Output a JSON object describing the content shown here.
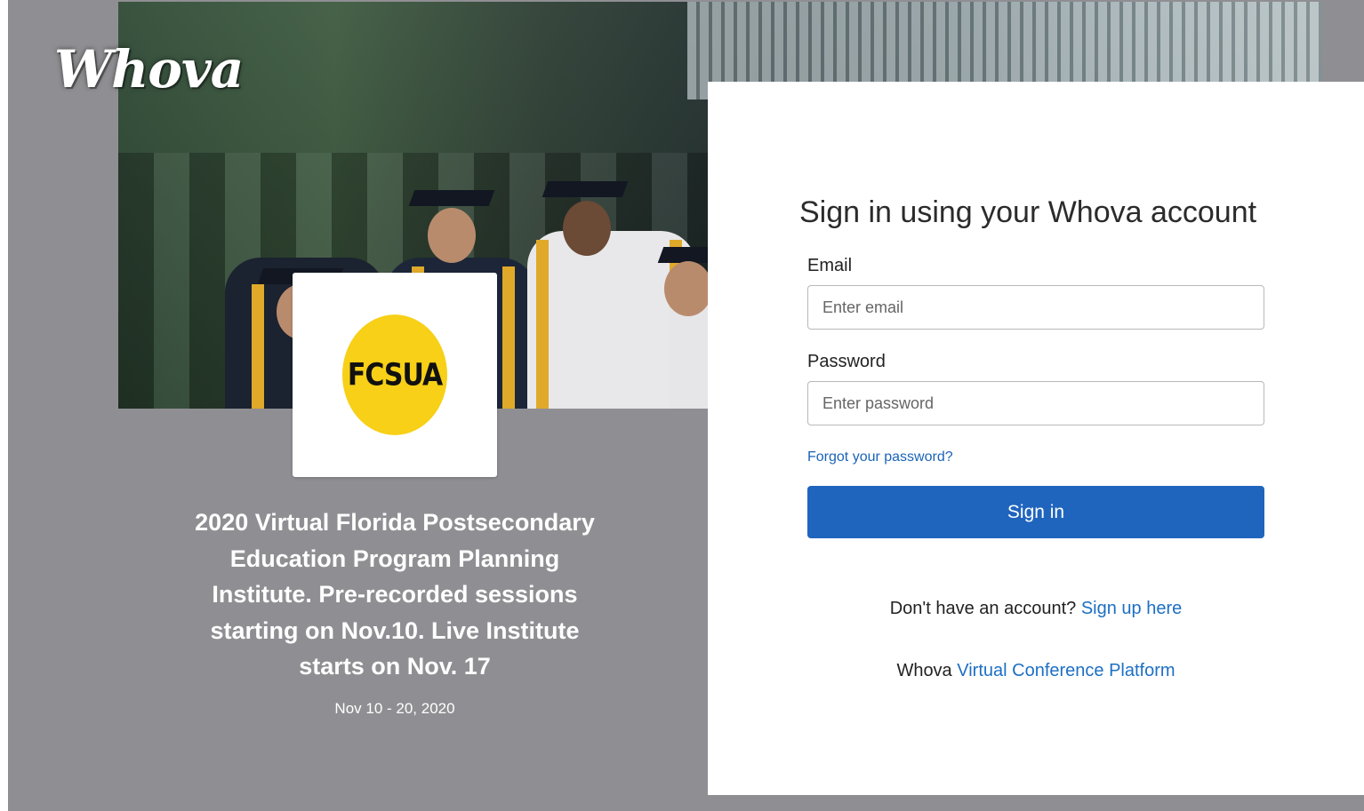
{
  "brand": {
    "logo_text": "Whova"
  },
  "event": {
    "badge_text": "FCSUA",
    "title": "2020 Virtual Florida Postsecondary Education Program Planning Institute. Pre-recorded sessions starting on Nov.10. Live Institute starts on Nov. 17",
    "dates": "Nov 10 - 20, 2020"
  },
  "signin": {
    "heading": "Sign in using your Whova account",
    "email_label": "Email",
    "email_placeholder": "Enter email",
    "password_label": "Password",
    "password_placeholder": "Enter password",
    "forgot_link": "Forgot your password?",
    "submit_label": "Sign in",
    "signup_prompt": "Don't have an account?",
    "signup_link": "Sign up here",
    "platform_prefix": "Whova",
    "platform_link": "Virtual Conference Platform"
  },
  "colors": {
    "background_gray": "#8f8f93",
    "primary_button": "#1f65be",
    "link": "#1d6fc4",
    "badge_yellow": "#f7d017"
  }
}
